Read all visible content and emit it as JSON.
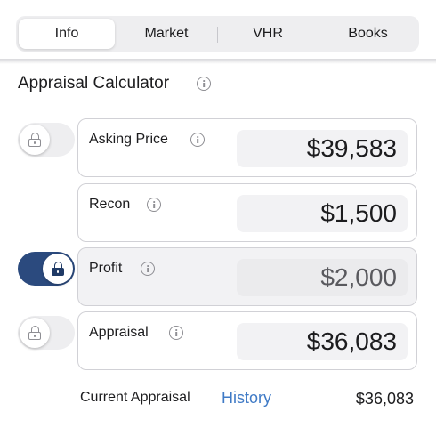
{
  "tabs": [
    {
      "label": "Info",
      "active": true
    },
    {
      "label": "Market",
      "active": false
    },
    {
      "label": "VHR",
      "active": false
    },
    {
      "label": "Books",
      "active": false
    }
  ],
  "section": {
    "title": "Appraisal Calculator"
  },
  "rows": [
    {
      "label": "Asking Price",
      "value": "$39,583",
      "locked": false
    },
    {
      "label": "Recon",
      "value": "$1,500"
    },
    {
      "label": "Profit",
      "value": "$2,000",
      "locked": true
    },
    {
      "label": "Appraisal",
      "value": "$36,083",
      "locked": false
    }
  ],
  "footer": {
    "label": "Current Appraisal",
    "link": "History",
    "value": "$36,083"
  },
  "colors": {
    "accent": "#2b4a7e",
    "link": "#3f7ac6"
  },
  "icons": [
    "info-icon",
    "lock-icon"
  ]
}
